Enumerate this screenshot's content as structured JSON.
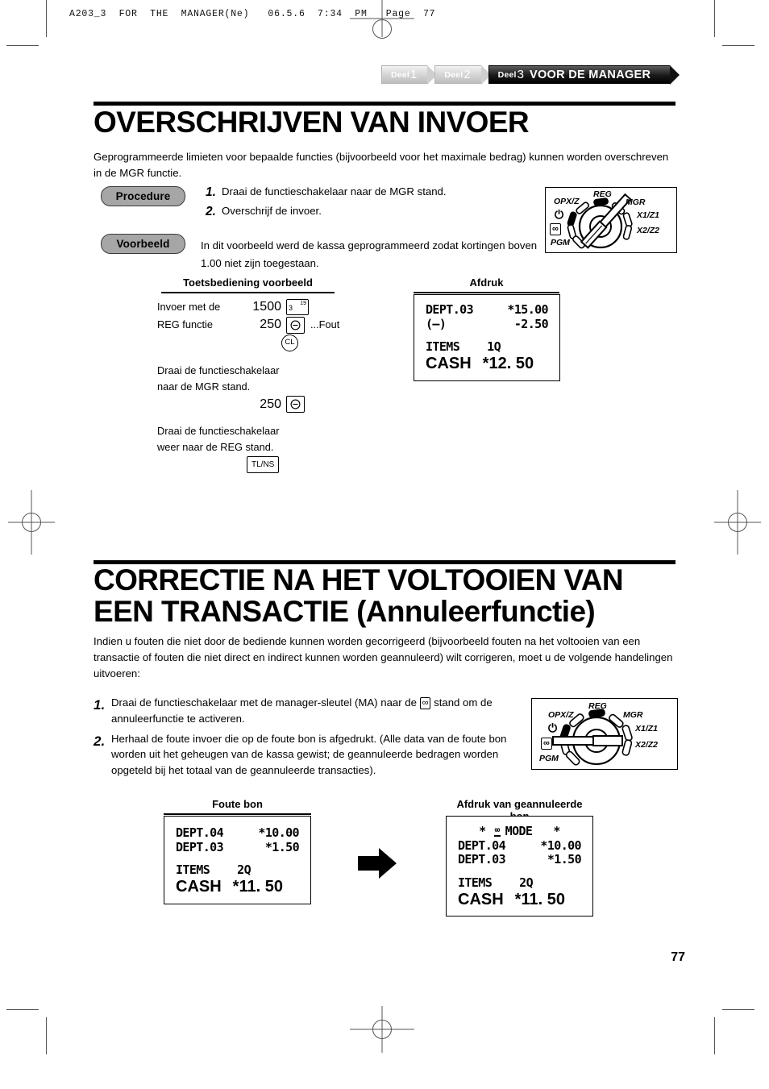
{
  "document": {
    "header_line": "A203_3  FOR  THE  MANAGER(Ne)   06.5.6  7:34  PM   Page  77",
    "page_number": "77"
  },
  "breadcrumb": {
    "tabs": [
      {
        "label": "Deel",
        "number": "1",
        "title": "",
        "active": false
      },
      {
        "label": "Deel",
        "number": "2",
        "title": "",
        "active": false
      },
      {
        "label": "Deel",
        "number": "3",
        "title": "VOOR DE MANAGER",
        "active": true
      }
    ]
  },
  "section1": {
    "title": "OVERSCHRIJVEN VAN INVOER",
    "intro": "Geprogrammeerde limieten voor bepaalde functies (bijvoorbeeld voor het maximale bedrag) kunnen worden overschreven in de MGR functie.",
    "procedure_badge": "Procedure",
    "example_badge": "Voorbeeld",
    "steps": [
      {
        "no": "1.",
        "text": "Draai de functieschakelaar naar de MGR stand."
      },
      {
        "no": "2.",
        "text": "Overschrijf de invoer."
      }
    ],
    "example_text": "In dit voorbeeld werd de kassa geprogrammeerd zodat kortingen boven 1.00 niet zijn toegestaan."
  },
  "dial1": {
    "labels": [
      "REG",
      "OPX/Z",
      "MGR",
      "X1/Z1",
      "X2/Z2",
      "PGM"
    ],
    "power_icon": "power-icon",
    "void_icon": "void-mode-icon",
    "key_position": "MGR"
  },
  "dial2": {
    "labels": [
      "REG",
      "OPX/Z",
      "MGR",
      "X1/Z1",
      "X2/Z2",
      "PGM"
    ],
    "power_icon": "power-icon",
    "void_icon": "void-mode-icon",
    "key_position": "VOID"
  },
  "keyexample": {
    "caption": "Toetsbediening voorbeeld",
    "rows": [
      {
        "label": "Invoer met de",
        "amount": "1500",
        "key": "dept-3-19",
        "key_label": "3",
        "key_sup": "19",
        "note": ""
      },
      {
        "label": "REG functie",
        "amount": "250",
        "key": "minus-key",
        "key_label": "⊖",
        "note": "...Fout"
      },
      {
        "label": "",
        "amount": "",
        "key": "clear-key",
        "key_label": "CL",
        "note": ""
      }
    ],
    "instruction1": "Draai de functieschakelaar\nnaar de MGR stand.",
    "amount2": "250",
    "key2_label": "⊖",
    "instruction2": "Draai de functieschakelaar\nweer naar de REG stand.",
    "key3_label": "TL/NS"
  },
  "printout1": {
    "caption": "Afdruk",
    "lines": [
      {
        "left": "DEPT.03",
        "right": "*15.00"
      },
      {
        "left": " (—)",
        "right": "-2.50"
      }
    ],
    "items_label": "ITEMS",
    "items_value": "1Q",
    "total_label": "CASH",
    "total_value": "*12. 50"
  },
  "section2": {
    "title": "CORRECTIE NA HET VOLTOOIEN VAN\nEEN TRANSACTIE (Annuleerfunctie)",
    "intro": "Indien u fouten die niet door de bediende kunnen worden gecorrigeerd (bijvoorbeeld fouten na het voltooien van een transactie of fouten die niet direct en indirect kunnen worden geannuleerd) wilt corrigeren, moet u de volgende handelingen uitvoeren:",
    "steps": [
      {
        "no": "1.",
        "text_before": "Draai de functieschakelaar met de manager-sleutel (MA) naar de ",
        "text_after": " stand om de annuleerfunctie te activeren."
      },
      {
        "no": "2.",
        "text_before": "Herhaal de foute invoer die op de foute bon is afgedrukt. (Alle data van de foute bon worden uit het geheugen van de kassa gewist; de geannuleerde bedragen worden opgeteld bij het totaal van de geannuleerde transacties).",
        "text_after": ""
      }
    ]
  },
  "printout2": {
    "caption": "Foute bon",
    "lines": [
      {
        "left": "DEPT.04",
        "right": "*10.00"
      },
      {
        "left": "DEPT.03",
        "right": "*1.50"
      }
    ],
    "items_label": "ITEMS",
    "items_value": "2Q",
    "total_label": "CASH",
    "total_value": "*11. 50"
  },
  "printout3": {
    "caption": "Afdruk van geannuleerde bon",
    "mode_prefix": "*",
    "mode_label": "MODE",
    "mode_suffix": "*",
    "lines": [
      {
        "left": "DEPT.04",
        "right": "*10.00"
      },
      {
        "left": "DEPT.03",
        "right": "*1.50"
      }
    ],
    "items_label": "ITEMS",
    "items_value": "2Q",
    "total_label": "CASH",
    "total_value": "*11. 50"
  },
  "arrow": {
    "name": "right-arrow-icon"
  }
}
